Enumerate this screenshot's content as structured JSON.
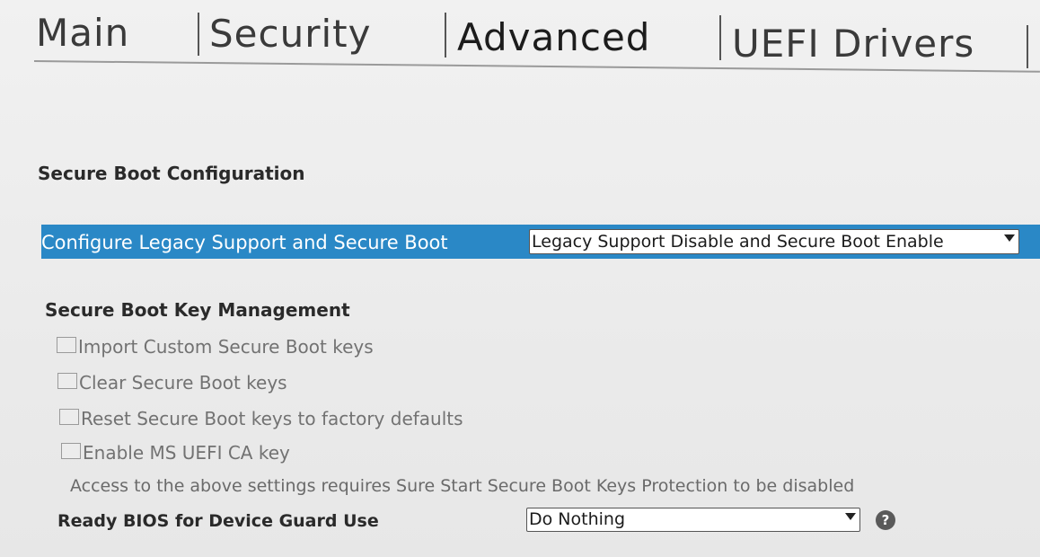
{
  "tabs": [
    {
      "label": "Main"
    },
    {
      "label": "Security"
    },
    {
      "label": "Advanced"
    },
    {
      "label": "UEFI Drivers"
    }
  ],
  "section": {
    "title": "Secure Boot Configuration"
  },
  "legacy": {
    "label": "Configure Legacy Support and Secure Boot",
    "value": "Legacy Support Disable and Secure Boot Enable"
  },
  "key_management": {
    "title": "Secure Boot Key Management",
    "options": [
      {
        "label": "Import Custom Secure Boot keys",
        "checked": false
      },
      {
        "label": "Clear Secure Boot keys",
        "checked": false
      },
      {
        "label": "Reset Secure Boot keys to factory defaults",
        "checked": false
      },
      {
        "label": "Enable MS UEFI CA key",
        "checked": false
      }
    ],
    "note": "Access to the above settings requires Sure Start Secure Boot Keys Protection to be disabled"
  },
  "device_guard": {
    "label": "Ready BIOS for Device Guard Use",
    "value": "Do Nothing",
    "help_icon": "question-mark"
  },
  "colors": {
    "highlight": "#2a88c6",
    "background": "#ececec"
  }
}
